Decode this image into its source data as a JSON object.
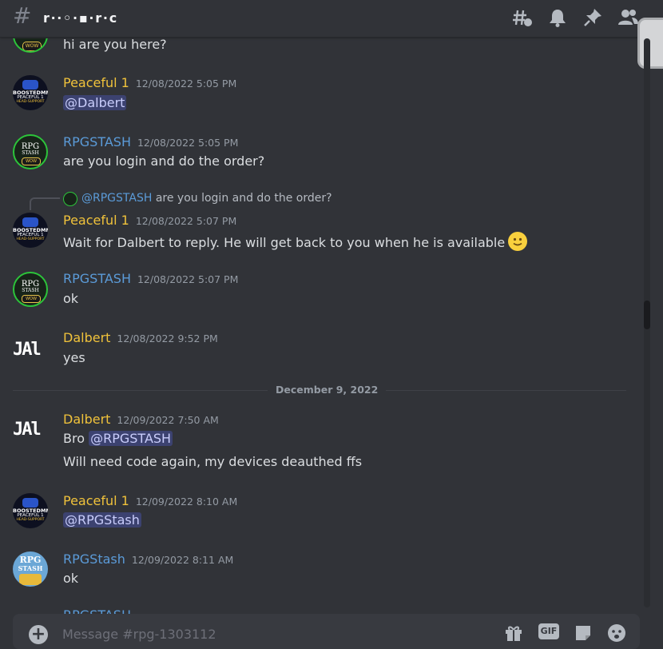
{
  "header": {
    "hash_glyph": "#",
    "channel_name": "r‧‧◦‧▪‧r‧c",
    "icons": [
      "threads-icon",
      "bell-icon",
      "pin-icon",
      "members-icon"
    ]
  },
  "messages": [
    {
      "author": "",
      "timestamp": "",
      "lines": [
        "hi are you here?"
      ]
    },
    {
      "author": "Peaceful 1",
      "timestamp": "12/08/2022 5:05 PM",
      "mention": "@Dalbert"
    },
    {
      "author": "RPGSTASH",
      "timestamp": "12/08/2022 5:05 PM",
      "lines": [
        "are you login and do the order?"
      ]
    },
    {
      "author": "Peaceful 1",
      "timestamp": "12/08/2022 5:07 PM",
      "reply": {
        "author": "@RPGSTASH",
        "text": "are you login and do the order?"
      },
      "lines": [
        "Wait for Dalbert to reply. He will get back to you when he is available"
      ]
    },
    {
      "author": "RPGSTASH",
      "timestamp": "12/08/2022 5:07 PM",
      "lines": [
        "ok"
      ]
    },
    {
      "author": "Dalbert",
      "timestamp": "12/08/2022 9:52 PM",
      "lines": [
        "yes"
      ]
    },
    {
      "author": "Dalbert",
      "timestamp": "12/09/2022 7:50 AM",
      "prefix": "Bro",
      "mention": "@RPGSTASH",
      "lines": [
        "Will need code again, my devices deauthed ffs"
      ]
    },
    {
      "author": "Peaceful 1",
      "timestamp": "12/09/2022 8:10 AM",
      "mention": "@RPGStash"
    },
    {
      "author": "RPGStash",
      "timestamp": "12/09/2022 8:11 AM",
      "lines": [
        "ok"
      ]
    },
    {
      "author": "RPGSTASH",
      "timestamp": "",
      "lines": []
    }
  ],
  "avatar_text": {
    "boosted_top": "BOOSTEDMMO",
    "boosted_mid": "PEACEFUL 1",
    "boosted_bot": "HEAD-SUPPORT",
    "rpg_top": "RPG",
    "rpg_bot": "STASH",
    "wow": "WOW",
    "dalbert": "JAl"
  },
  "date_divider": "December 9, 2022",
  "composer": {
    "plus": "+",
    "placeholder": "Message #rpg-1303112",
    "gif_label": "GIF"
  },
  "colors": {
    "background": "#313338",
    "gold_author": "#f0c23b",
    "blue_author": "#5b9bd8",
    "mention_bg": "#3c4270"
  }
}
